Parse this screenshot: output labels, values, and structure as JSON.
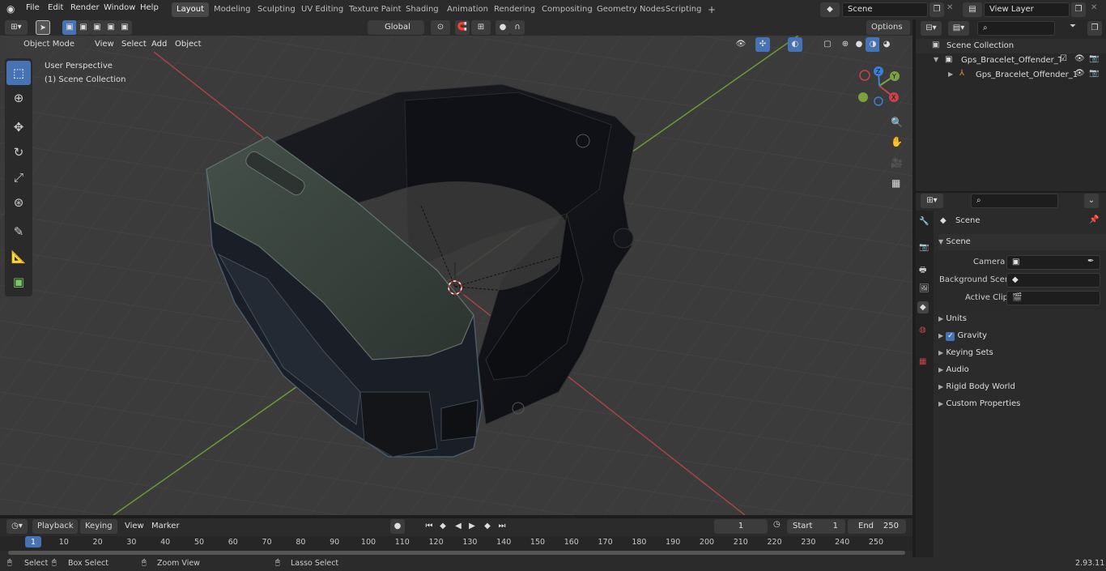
{
  "topbar": {
    "menus": [
      "File",
      "Edit",
      "Render",
      "Window",
      "Help"
    ],
    "workspaces": [
      "Layout",
      "Modeling",
      "Sculpting",
      "UV Editing",
      "Texture Paint",
      "Shading",
      "Animation",
      "Rendering",
      "Compositing",
      "Geometry Nodes",
      "Scripting"
    ],
    "add_tab": "+",
    "scene": "Scene",
    "view_layer": "View Layer"
  },
  "viewport_header": {
    "mode": "Object Mode",
    "menus": [
      "View",
      "Select",
      "Add",
      "Object"
    ],
    "orientation": "Global",
    "options": "Options"
  },
  "viewport": {
    "perspective": "User Perspective",
    "collection": "(1) Scene Collection",
    "gizmo_axes": {
      "x": "X",
      "y": "Y",
      "z": "Z"
    }
  },
  "outliner": {
    "root": "Scene Collection",
    "items": [
      "Gps_Bracelet_Offender_Track",
      "Gps_Bracelet_Offender_1"
    ]
  },
  "properties": {
    "title": "Scene",
    "section": "Scene",
    "fields": [
      {
        "label": "Camera"
      },
      {
        "label": "Background Scene"
      },
      {
        "label": "Active Clip"
      }
    ],
    "panels": [
      "Units",
      "Gravity",
      "Keying Sets",
      "Audio",
      "Rigid Body World",
      "Custom Properties"
    ]
  },
  "timeline": {
    "menus": [
      "Playback",
      "Keying",
      "View",
      "Marker"
    ],
    "current_frame": "1",
    "start_label": "Start",
    "start": "1",
    "end_label": "End",
    "end": "250",
    "ruler": [
      "1",
      "10",
      "20",
      "30",
      "40",
      "50",
      "60",
      "70",
      "80",
      "90",
      "100",
      "110",
      "120",
      "130",
      "140",
      "150",
      "160",
      "170",
      "180",
      "190",
      "200",
      "210",
      "220",
      "230",
      "240",
      "250"
    ]
  },
  "statusbar": {
    "select": "Select",
    "box_select": "Box Select",
    "zoom_view": "Zoom View",
    "lasso_select": "Lasso Select",
    "version": "2.93.11"
  },
  "colors": {
    "accent": "#4772b3",
    "x_axis": "#c8434c",
    "y_axis": "#7aa23f",
    "z_axis": "#3b7fd6"
  }
}
